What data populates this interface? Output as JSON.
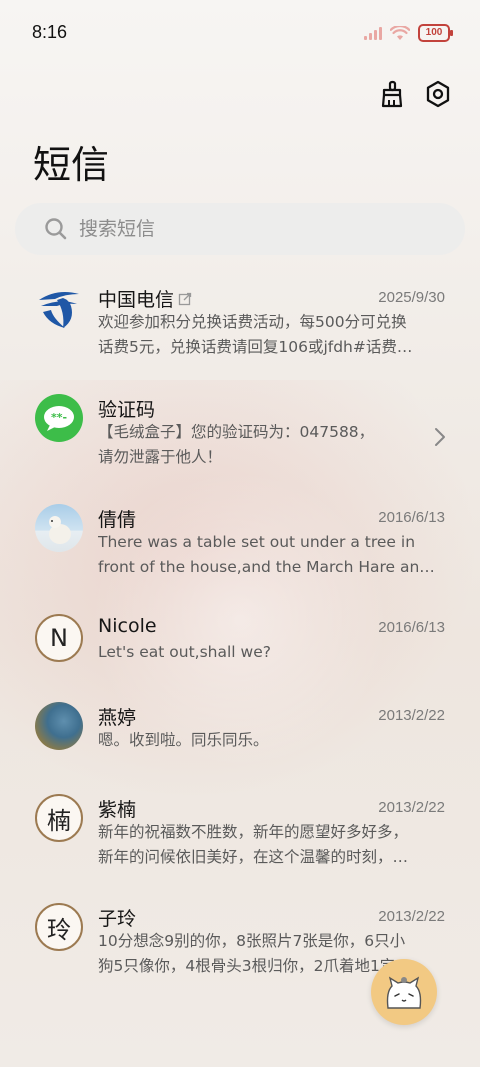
{
  "status": {
    "time": "8:16",
    "battery": "100"
  },
  "header": {
    "title": "短信"
  },
  "search": {
    "placeholder": "搜索短信"
  },
  "conversations": [
    {
      "name": "中国电信",
      "date": "2025/9/30",
      "line1": "欢迎参加积分兑换话费活动，每500分可兑换",
      "line2": "话费5元，兑换话费请回复106或jfdh#话费…"
    },
    {
      "name": "验证码",
      "date": "",
      "line1": "【毛绒盒子】您的验证码为：047588，",
      "line2": "请勿泄露于他人！"
    },
    {
      "name": "倩倩",
      "date": "2016/6/13",
      "line1": "There was a table set out under a tree in",
      "line2": "front of the house,and the March Hare an…"
    },
    {
      "name": "Nicole",
      "date": "2016/6/13",
      "avatar_letter": "N",
      "line1": "Let's eat out,shall we?",
      "line2": ""
    },
    {
      "name": "燕婷",
      "date": "2013/2/22",
      "line1": "嗯。收到啦。同乐同乐。",
      "line2": ""
    },
    {
      "name": "紫楠",
      "date": "2013/2/22",
      "avatar_letter": "楠",
      "line1": "新年的祝福数不胜数，新年的愿望好多好多，",
      "line2": "新年的问候依旧美好，在这个温馨的时刻，…"
    },
    {
      "name": "子玲",
      "date": "2013/2/22",
      "avatar_letter": "玲",
      "line1": "10分想念9别的你，8张照片7张是你，6只小",
      "line2": "狗5只像你，4根骨头3根归你，2爪着地1定…"
    }
  ],
  "colors": {
    "telecom_blue": "#1f57a6",
    "wechat_green": "#3dbd49",
    "fab": "#f2c983"
  }
}
